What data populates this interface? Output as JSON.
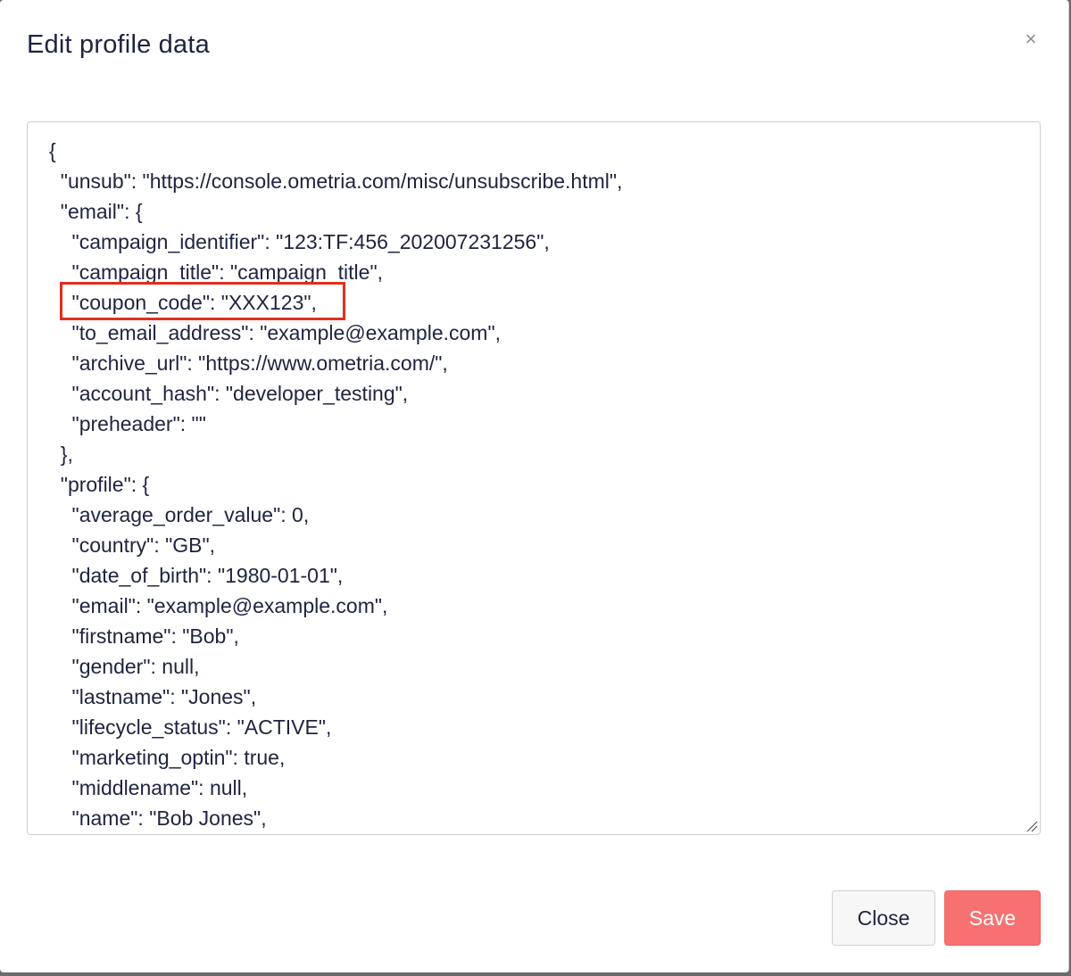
{
  "modal": {
    "title": "Edit profile data",
    "close_icon": "close-icon",
    "close_glyph": "×"
  },
  "editor": {
    "lines": [
      "{",
      "  \"unsub\": \"https://console.ometria.com/misc/unsubscribe.html\",",
      "  \"email\": {",
      "    \"campaign_identifier\": \"123:TF:456_202007231256\",",
      "    \"campaign_title\": \"campaign_title\",",
      "    \"coupon_code\": \"XXX123\",",
      "    \"to_email_address\": \"example@example.com\",",
      "    \"archive_url\": \"https://www.ometria.com/\",",
      "    \"account_hash\": \"developer_testing\",",
      "    \"preheader\": \"\"",
      "  },",
      "  \"profile\": {",
      "    \"average_order_value\": 0,",
      "    \"country\": \"GB\",",
      "    \"date_of_birth\": \"1980-01-01\",",
      "    \"email\": \"example@example.com\",",
      "    \"firstname\": \"Bob\",",
      "    \"gender\": null,",
      "    \"lastname\": \"Jones\",",
      "    \"lifecycle_status\": \"ACTIVE\",",
      "    \"marketing_optin\": true,",
      "    \"middlename\": null,",
      "    \"name\": \"Bob Jones\","
    ],
    "highlighted_line": "    \"coupon_code\": \"XXX123\",",
    "highlight_color": "#e0301e"
  },
  "footer": {
    "close_label": "Close",
    "save_label": "Save",
    "save_color": "#f87171"
  }
}
